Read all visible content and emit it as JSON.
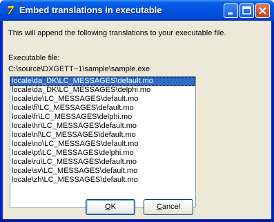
{
  "window": {
    "title": "Embed translations in executable",
    "icon": "delphi-icon"
  },
  "titlebar_buttons": [
    "minimize-icon",
    "maximize-icon",
    "close-icon"
  ],
  "intro_text": "This will append the following translations to your executable file.",
  "executable_label": "Executable file:",
  "executable_path": "C:\\source\\DXGETT~1\\sample\\sample.exe",
  "translations": [
    "locale\\da_DK\\LC_MESSAGES\\default.mo",
    "locale\\da_DK\\LC_MESSAGES\\delphi.mo",
    "locale\\de\\LC_MESSAGES\\default.mo",
    "locale\\fi\\LC_MESSAGES\\default.mo",
    "locale\\fr\\LC_MESSAGES\\delphi.mo",
    "locale\\hr\\LC_MESSAGES\\default.mo",
    "locale\\nl\\LC_MESSAGES\\default.mo",
    "locale\\no\\LC_MESSAGES\\default.mo",
    "locale\\pt\\LC_MESSAGES\\delphi.mo",
    "locale\\ru\\LC_MESSAGES\\default.mo",
    "locale\\sv\\LC_MESSAGES\\default.mo",
    "locale\\zh\\LC_MESSAGES\\default.mo"
  ],
  "selected_index": 0,
  "buttons": {
    "ok": {
      "accel": "O",
      "rest": "K"
    },
    "cancel": {
      "accel": "C",
      "rest": "ancel"
    }
  },
  "colors": {
    "titlebar": "#0054e3",
    "selection": "#316ac5",
    "face": "#ece9d8"
  }
}
